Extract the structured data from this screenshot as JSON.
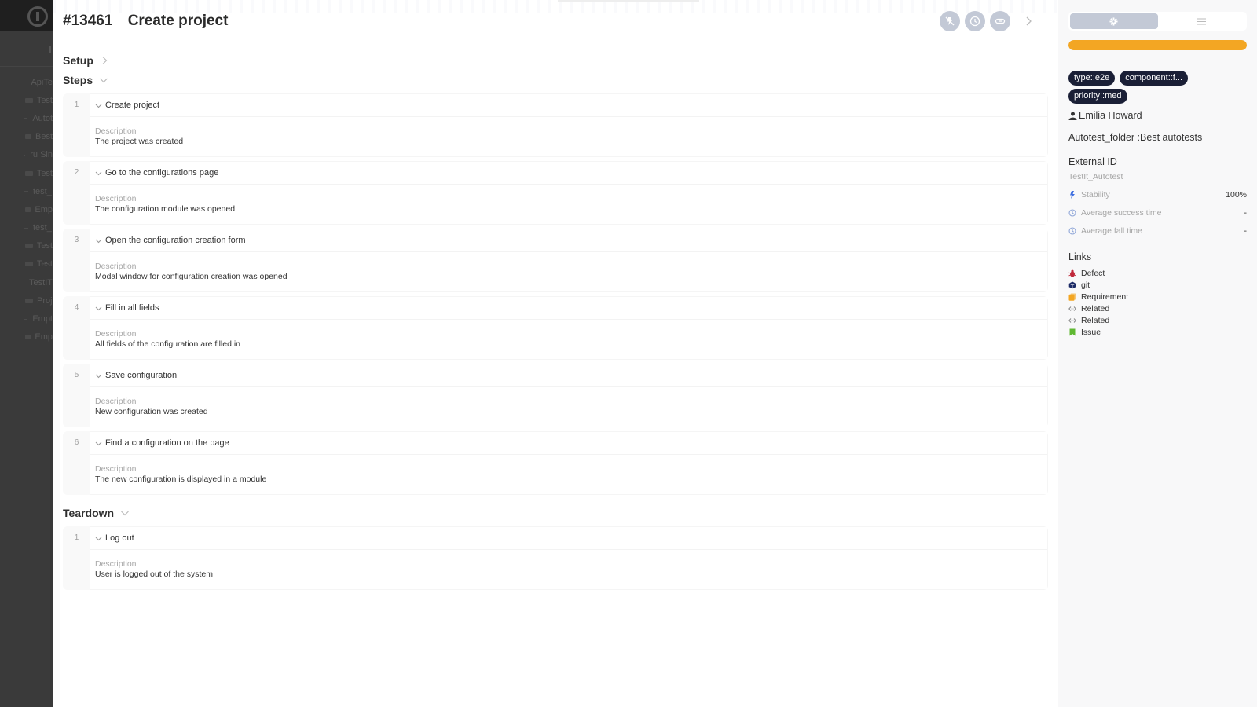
{
  "background_app": {
    "header_fragment": "T",
    "tree": [
      {
        "label": "ApiTe",
        "kind": "suite"
      },
      {
        "label": "Test",
        "kind": "folder"
      },
      {
        "label": "Autot",
        "kind": "suite"
      },
      {
        "label": "Best",
        "kind": "folder"
      },
      {
        "label": "ru Sin",
        "kind": "suite"
      },
      {
        "label": "Test",
        "kind": "folder"
      },
      {
        "label": "test_",
        "kind": "suite"
      },
      {
        "label": "Emp",
        "kind": "folder"
      },
      {
        "label": "test_",
        "kind": "suite"
      },
      {
        "label": "Test",
        "kind": "folder"
      },
      {
        "label": "Test",
        "kind": "folder"
      },
      {
        "label": "TestIT",
        "kind": "suite"
      },
      {
        "label": "Proj",
        "kind": "folder"
      },
      {
        "label": "Empt",
        "kind": "suite"
      },
      {
        "label": "Emp",
        "kind": "folder"
      }
    ]
  },
  "header": {
    "id": "#13461",
    "title": "Create project",
    "actions": [
      {
        "name": "unflaky-button",
        "icon": "flaky-off-icon"
      },
      {
        "name": "history-button",
        "icon": "clock-icon"
      },
      {
        "name": "link-button",
        "icon": "link-icon"
      }
    ],
    "next_icon": "chevron-right-icon"
  },
  "setup": {
    "label": "Setup",
    "expanded": false
  },
  "steps_section": {
    "label": "Steps",
    "expanded": true,
    "description_label": "Description",
    "steps": [
      {
        "num": "1",
        "title": "Create project",
        "description": "The project was created"
      },
      {
        "num": "2",
        "title": "Go to the configurations page",
        "description": "The configuration module was opened"
      },
      {
        "num": "3",
        "title": "Open the configuration creation form",
        "description": "Modal window for configuration creation was opened"
      },
      {
        "num": "4",
        "title": "Fill in all fields",
        "description": "All fields of the configuration are filled in"
      },
      {
        "num": "5",
        "title": "Save configuration",
        "description": "New configuration was created"
      },
      {
        "num": "6",
        "title": "Find a configuration on the page",
        "description": "The new configuration is displayed in a module"
      }
    ]
  },
  "teardown": {
    "label": "Teardown",
    "expanded": true,
    "steps": [
      {
        "num": "1",
        "title": "Log out",
        "description": "User is logged out of the system"
      }
    ]
  },
  "sidebar": {
    "tabs": [
      {
        "name": "settings",
        "icon": "gear-icon",
        "active": true
      },
      {
        "name": "details",
        "icon": "menu-icon",
        "active": false
      }
    ],
    "progress_percent": 100,
    "progress_color": "#f3a623",
    "tags": [
      "type::e2e",
      "component::f...",
      "priority::med"
    ],
    "owner": "Emilia Howard",
    "folder": "Autotest_folder :Best autotests",
    "external_id_label": "External ID",
    "external_id": "TestIt_Autotest",
    "metrics": [
      {
        "label": "Stability",
        "value": "100%",
        "icon": "lightning-icon"
      },
      {
        "label": "Average success time",
        "value": "-",
        "icon": "clock-icon"
      },
      {
        "label": "Average fall time",
        "value": "-",
        "icon": "clock-icon"
      }
    ],
    "links_title": "Links",
    "links": [
      {
        "label": "Defect",
        "icon": "bug-icon",
        "color": "#c0283a"
      },
      {
        "label": "git",
        "icon": "cube-icon",
        "color": "#1c2a66"
      },
      {
        "label": "Requirement",
        "icon": "requirement-icon",
        "color": "#f3a623"
      },
      {
        "label": "Related",
        "icon": "related-arrows-icon",
        "color": "#888888"
      },
      {
        "label": "Related",
        "icon": "related-arrows-icon",
        "color": "#888888"
      },
      {
        "label": "Issue",
        "icon": "bookmark-icon",
        "color": "#5fb832"
      }
    ]
  }
}
